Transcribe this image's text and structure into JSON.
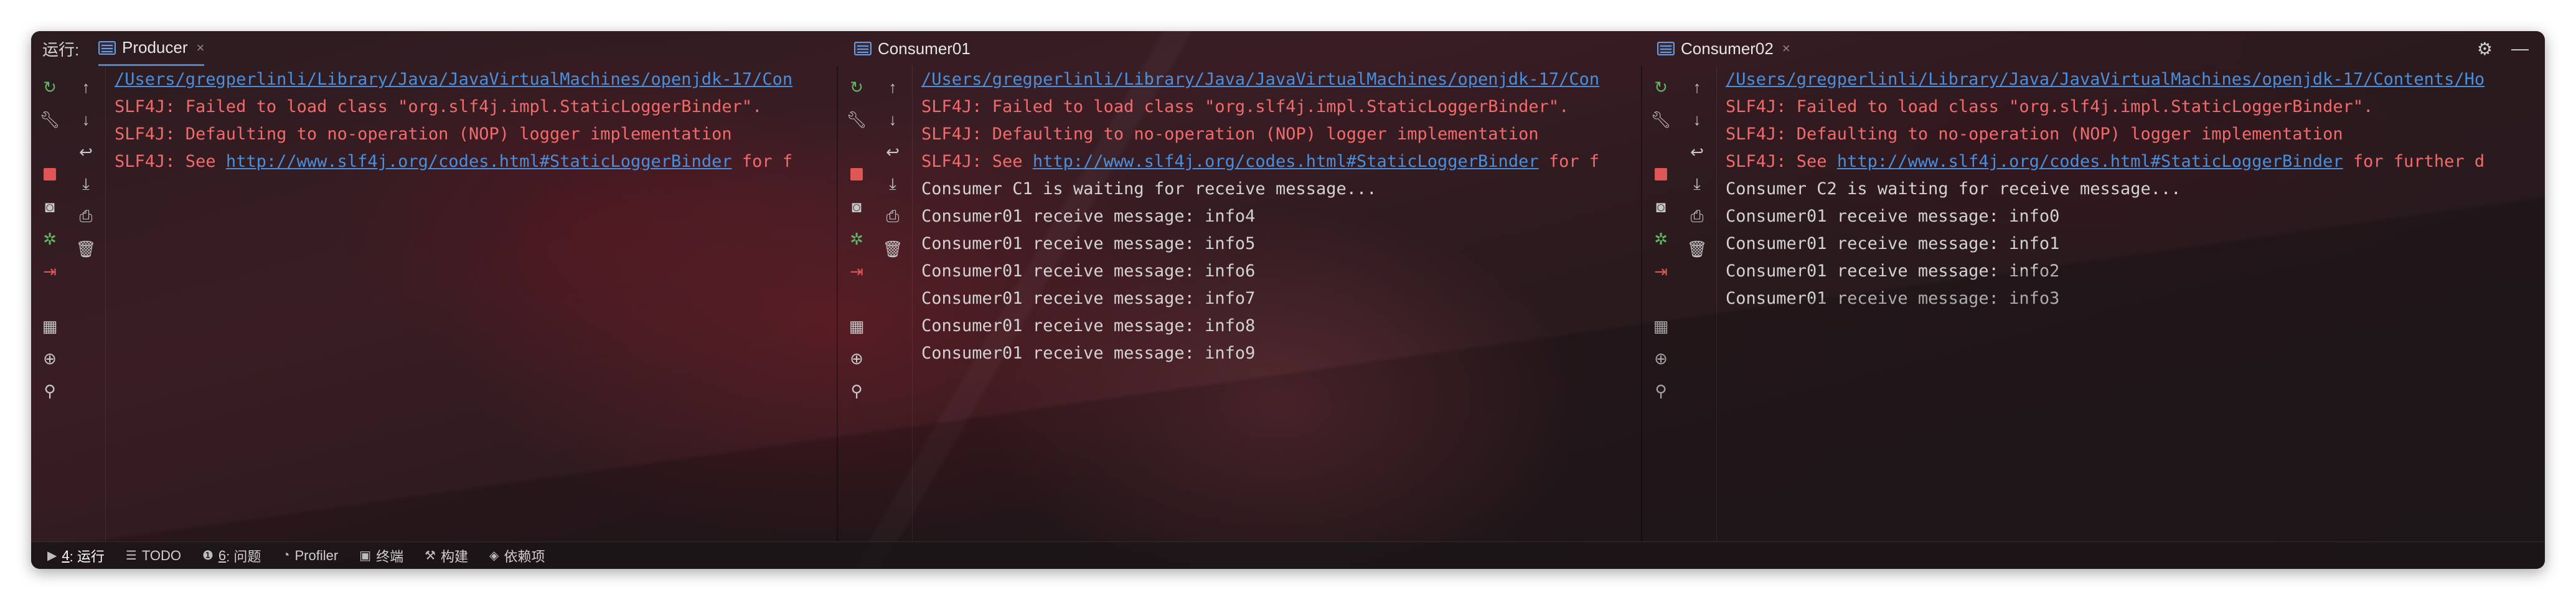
{
  "titlebar": {
    "run_label": "运行:",
    "tabs": [
      {
        "label": "Producer",
        "close": "×"
      },
      {
        "label": "Consumer01",
        "close": "×"
      },
      {
        "label": "Consumer02",
        "close": "×"
      }
    ],
    "settings_glyph": "⚙",
    "minimize_glyph": "—"
  },
  "toolbar_icons": {
    "col1": [
      "rerun-icon",
      "wrench-icon",
      "stop-icon",
      "camera-icon",
      "debug-bug-icon",
      "exit-icon",
      "layout-icon",
      "target-icon",
      "pin-icon"
    ],
    "col2": [
      "arrow-up-icon",
      "arrow-down-icon",
      "soft-wrap-icon",
      "scroll-to-end-icon",
      "print-icon",
      "trash-icon"
    ]
  },
  "panes": {
    "producer": {
      "lines": [
        {
          "kind": "link",
          "text": "/Users/gregperlinli/Library/Java/JavaVirtualMachines/openjdk-17/Con"
        },
        {
          "kind": "err",
          "text": "SLF4J: Failed to load class \"org.slf4j.impl.StaticLoggerBinder\"."
        },
        {
          "kind": "err",
          "text": "SLF4J: Defaulting to no-operation (NOP) logger implementation"
        },
        {
          "kind": "err",
          "prefix": "SLF4J: See ",
          "link": "http://www.slf4j.org/codes.html#StaticLoggerBinder",
          "suffix": " for f"
        }
      ]
    },
    "consumer01": {
      "lines": [
        {
          "kind": "link",
          "text": "/Users/gregperlinli/Library/Java/JavaVirtualMachines/openjdk-17/Con"
        },
        {
          "kind": "err",
          "text": "SLF4J: Failed to load class \"org.slf4j.impl.StaticLoggerBinder\"."
        },
        {
          "kind": "err",
          "text": "SLF4J: Defaulting to no-operation (NOP) logger implementation"
        },
        {
          "kind": "err",
          "prefix": "SLF4J: See ",
          "link": "http://www.slf4j.org/codes.html#StaticLoggerBinder",
          "suffix": " for f"
        },
        {
          "kind": "out",
          "text": "Consumer C1 is waiting for receive message..."
        },
        {
          "kind": "out",
          "text": "Consumer01 receive message: info4"
        },
        {
          "kind": "out",
          "text": "Consumer01 receive message: info5"
        },
        {
          "kind": "out",
          "text": "Consumer01 receive message: info6"
        },
        {
          "kind": "out",
          "text": "Consumer01 receive message: info7"
        },
        {
          "kind": "out",
          "text": "Consumer01 receive message: info8"
        },
        {
          "kind": "out",
          "text": "Consumer01 receive message: info9"
        }
      ]
    },
    "consumer02": {
      "lines": [
        {
          "kind": "link",
          "text": "/Users/gregperlinli/Library/Java/JavaVirtualMachines/openjdk-17/Contents/Ho"
        },
        {
          "kind": "err",
          "text": "SLF4J: Failed to load class \"org.slf4j.impl.StaticLoggerBinder\"."
        },
        {
          "kind": "err",
          "text": "SLF4J: Defaulting to no-operation (NOP) logger implementation"
        },
        {
          "kind": "err",
          "prefix": "SLF4J: See ",
          "link": "http://www.slf4j.org/codes.html#StaticLoggerBinder",
          "suffix": " for further d"
        },
        {
          "kind": "out",
          "text": "Consumer C2 is waiting for receive message..."
        },
        {
          "kind": "out",
          "text": "Consumer01 receive message: info0"
        },
        {
          "kind": "out",
          "text": "Consumer01 receive message: info1"
        },
        {
          "kind": "out",
          "text": "Consumer01 receive message: info2"
        },
        {
          "kind": "out",
          "text": "Consumer01 receive message: info3"
        }
      ]
    }
  },
  "statusbar": {
    "items": [
      {
        "icon": "▶",
        "num": "4",
        "label": ": 运行"
      },
      {
        "icon": "☰",
        "num": "",
        "label": "TODO"
      },
      {
        "icon": "❶",
        "num": "6",
        "label": ": 问题"
      },
      {
        "icon": "◔",
        "num": "",
        "label": "Profiler"
      },
      {
        "icon": "▣",
        "num": "",
        "label": "终端"
      },
      {
        "icon": "⚒",
        "num": "",
        "label": "构建"
      },
      {
        "icon": "◈",
        "num": "",
        "label": "依赖项"
      }
    ]
  },
  "colors": {
    "link": "#4a8fdb",
    "error": "#f26a6a",
    "output": "#d2d2d2",
    "run_green": "#5fb865",
    "stop_red": "#e05555"
  }
}
